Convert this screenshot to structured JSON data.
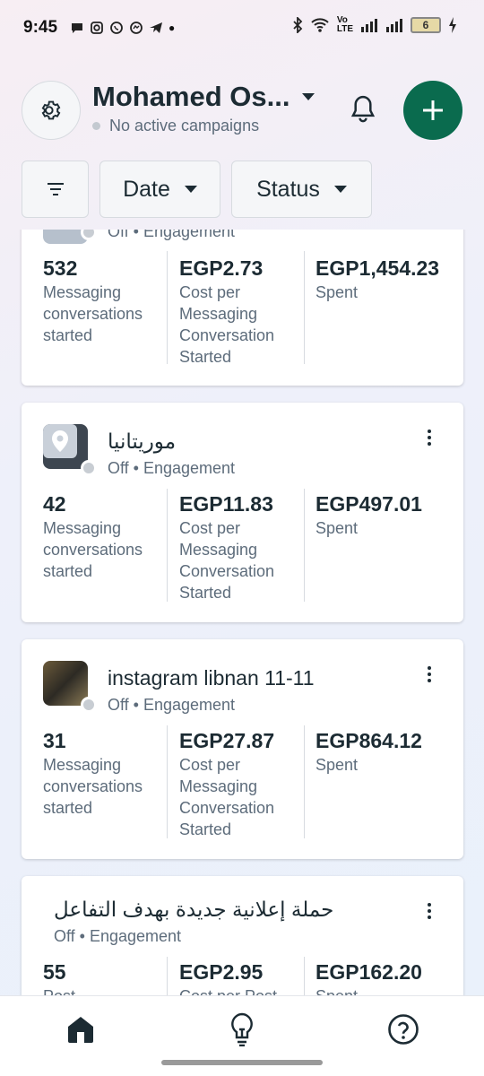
{
  "status_bar": {
    "time": "9:45",
    "battery": "6"
  },
  "header": {
    "account_name": "Mohamed Os...",
    "campaign_status": "No active campaigns"
  },
  "filters": {
    "date_label": "Date",
    "status_label": "Status"
  },
  "cards": [
    {
      "status_line": "Off • Engagement",
      "metrics": [
        {
          "value": "532",
          "label": "Messaging conversations started"
        },
        {
          "value": "EGP2.73",
          "label": "Cost per Messaging Conversation Started"
        },
        {
          "value": "EGP1,454.23",
          "label": "Spent"
        }
      ]
    },
    {
      "name": "موريتانيا",
      "status_line": "Off • Engagement",
      "metrics": [
        {
          "value": "42",
          "label": "Messaging conversations started"
        },
        {
          "value": "EGP11.83",
          "label": "Cost per Messaging Conversation Started"
        },
        {
          "value": "EGP497.01",
          "label": "Spent"
        }
      ]
    },
    {
      "name": "instagram libnan 11-11",
      "status_line": "Off • Engagement",
      "metrics": [
        {
          "value": "31",
          "label": "Messaging conversations started"
        },
        {
          "value": "EGP27.87",
          "label": "Cost per Messaging Conversation Started"
        },
        {
          "value": "EGP864.12",
          "label": "Spent"
        }
      ]
    },
    {
      "name": "حملة إعلانية جديدة بهدف التفاعل",
      "status_line": "Off • Engagement",
      "metrics": [
        {
          "value": "55",
          "label": "Post"
        },
        {
          "value": "EGP2.95",
          "label": "Cost per Post"
        },
        {
          "value": "EGP162.20",
          "label": "Spent"
        }
      ]
    }
  ],
  "colors": {
    "accent": "#0a6b4e",
    "text": "#1c2b33",
    "muted": "#5d6c7b"
  }
}
